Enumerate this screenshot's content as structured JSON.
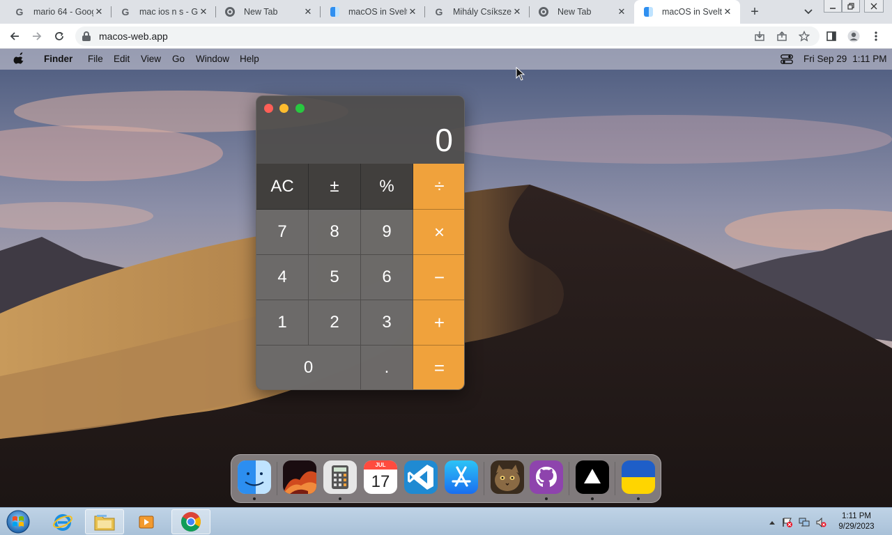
{
  "browser": {
    "tabs": [
      {
        "title": "mario 64 - Goog",
        "favicon": "google-icon"
      },
      {
        "title": "mac ios n s - Go",
        "favicon": "google-icon"
      },
      {
        "title": "New Tab",
        "favicon": "chrome-icon"
      },
      {
        "title": "macOS in Svelte",
        "favicon": "finder-icon"
      },
      {
        "title": "Mihály Csíkszen",
        "favicon": "google-icon"
      },
      {
        "title": "New Tab",
        "favicon": "chrome-icon"
      },
      {
        "title": "macOS in Svelte",
        "favicon": "finder-icon",
        "active": true
      }
    ],
    "close_glyph": "✕",
    "new_tab_glyph": "+",
    "tab_search_glyph": "⌄",
    "url": "macos-web.app"
  },
  "menubar": {
    "app_name": "Finder",
    "items": [
      "File",
      "Edit",
      "View",
      "Go",
      "Window",
      "Help"
    ],
    "date": "Fri Sep 29",
    "time": "1:11 PM"
  },
  "calculator": {
    "display": "0",
    "keys": {
      "ac": "AC",
      "plusminus": "±",
      "percent": "%",
      "divide": "÷",
      "seven": "7",
      "eight": "8",
      "nine": "9",
      "multiply": "×",
      "four": "4",
      "five": "5",
      "six": "6",
      "minus": "−",
      "one": "1",
      "two": "2",
      "three": "3",
      "plus": "+",
      "zero": "0",
      "decimal": ".",
      "equals": "="
    },
    "colors": {
      "operator": "#f0a23c",
      "close": "#ff5f57",
      "minimize": "#febc2e",
      "maximize": "#28c840"
    }
  },
  "dock": {
    "apps": [
      "finder-icon",
      "wallpapers-icon",
      "calculator-icon",
      "calendar-icon",
      "vscode-icon",
      "app-store-icon",
      "cat-icon",
      "github-icon",
      "vercel-icon",
      "ukraine-icon"
    ],
    "calendar_month": "JUL",
    "calendar_day": "17"
  },
  "taskbar": {
    "time": "1:11 PM",
    "date": "9/29/2023"
  }
}
